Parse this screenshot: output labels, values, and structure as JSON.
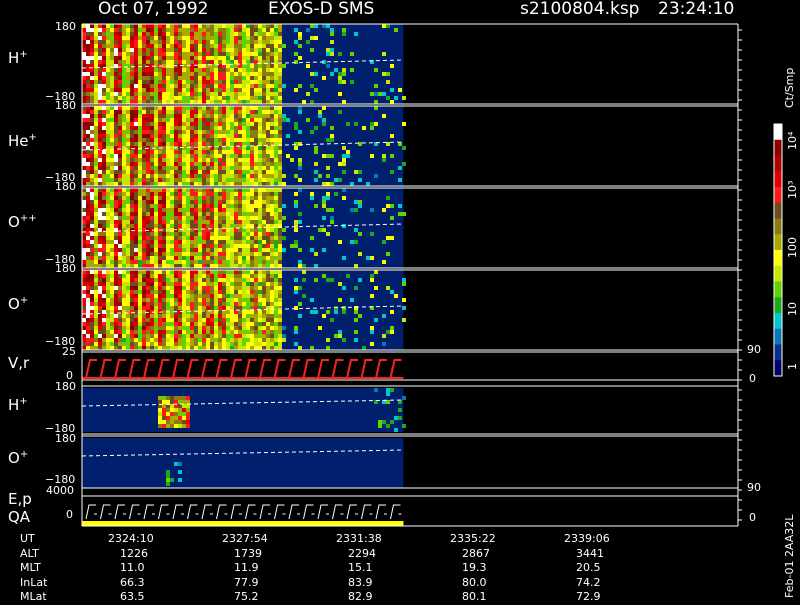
{
  "header": {
    "date": "Oct 07, 1992",
    "instrument": "EXOS-D SMS",
    "file": "s2100804.ksp",
    "time": "23:24:10"
  },
  "panels": [
    {
      "label": "H",
      "charge": "+",
      "ymax": "180",
      "ymin": "−180"
    },
    {
      "label": "He",
      "charge": "+",
      "ymax": "180",
      "ymin": "−180"
    },
    {
      "label": "O",
      "charge": "++",
      "ymax": "180",
      "ymin": "−180"
    },
    {
      "label": "O",
      "charge": "+",
      "ymax": "180",
      "ymin": "−180"
    },
    {
      "label": "V,r",
      "charge": "",
      "ymax": "25",
      "ymin": "0",
      "rmax": "90",
      "rmin": "0"
    },
    {
      "label": "H",
      "charge": "+",
      "ymax": "180",
      "ymin": "−180"
    },
    {
      "label": "O",
      "charge": "+",
      "ymax": "180",
      "ymin": "−180"
    },
    {
      "label": "E,p",
      "sublabel": "QA",
      "charge": "",
      "ymax": "4000",
      "ymin": "0",
      "rmax": "90",
      "rmin": "0"
    }
  ],
  "colorbar": {
    "unit": "Ct/Smp",
    "labels": [
      "10⁴",
      "10³",
      "100",
      "10",
      "1"
    ],
    "colors": [
      "#ffffff",
      "#8b0000",
      "#b00000",
      "#dc0000",
      "#ff1a1a",
      "#6b4c1a",
      "#8a7a10",
      "#a8a800",
      "#ffff00",
      "#c8e600",
      "#5fd400",
      "#1ea81e",
      "#00c8c8",
      "#0a78b4",
      "#0a2e8c",
      "#000064"
    ]
  },
  "footer": {
    "row_labels": [
      "UT",
      "ALT",
      "MLT",
      "InLat",
      "MLat"
    ],
    "columns": [
      {
        "UT": "2324:10",
        "ALT": "1226",
        "MLT": "11.0",
        "InLat": "66.3",
        "MLat": "63.5"
      },
      {
        "UT": "2327:54",
        "ALT": "1739",
        "MLT": "11.9",
        "InLat": "77.9",
        "MLat": "75.2"
      },
      {
        "UT": "2331:38",
        "ALT": "2294",
        "MLT": "15.1",
        "InLat": "83.9",
        "MLat": "82.9"
      },
      {
        "UT": "2335:22",
        "ALT": "2867",
        "MLT": "19.3",
        "InLat": "80.0",
        "MLat": "80.1"
      },
      {
        "UT": "2339:06",
        "ALT": "3441",
        "MLT": "20.5",
        "InLat": "74.2",
        "MLat": "72.9"
      }
    ]
  },
  "side_label": "Feb-01 2AA32L",
  "chart_data": {
    "type": "heatmap",
    "title": "Oct 07, 1992   EXOS-D SMS",
    "x_ticks": [
      "2324:10",
      "2327:54",
      "2331:38",
      "2335:22",
      "2339:06"
    ],
    "data_coverage_end_fraction": 0.49,
    "panels": [
      {
        "name": "H+",
        "ylim": [
          -180,
          180
        ],
        "scale": "pitch angle"
      },
      {
        "name": "He+",
        "ylim": [
          -180,
          180
        ]
      },
      {
        "name": "O++",
        "ylim": [
          -180,
          180
        ]
      },
      {
        "name": "O+",
        "ylim": [
          -180,
          180
        ]
      },
      {
        "name": "V,r",
        "ylim": [
          0,
          25
        ],
        "right_ylim": [
          0,
          90
        ]
      },
      {
        "name": "H+",
        "ylim": [
          -180,
          180
        ]
      },
      {
        "name": "O+",
        "ylim": [
          -180,
          180
        ]
      },
      {
        "name": "E,p QA",
        "ylim": [
          0,
          4000
        ],
        "right_ylim": [
          0,
          90
        ]
      }
    ],
    "colorbar_scale": "log",
    "colorbar_range": [
      1,
      10000
    ]
  }
}
